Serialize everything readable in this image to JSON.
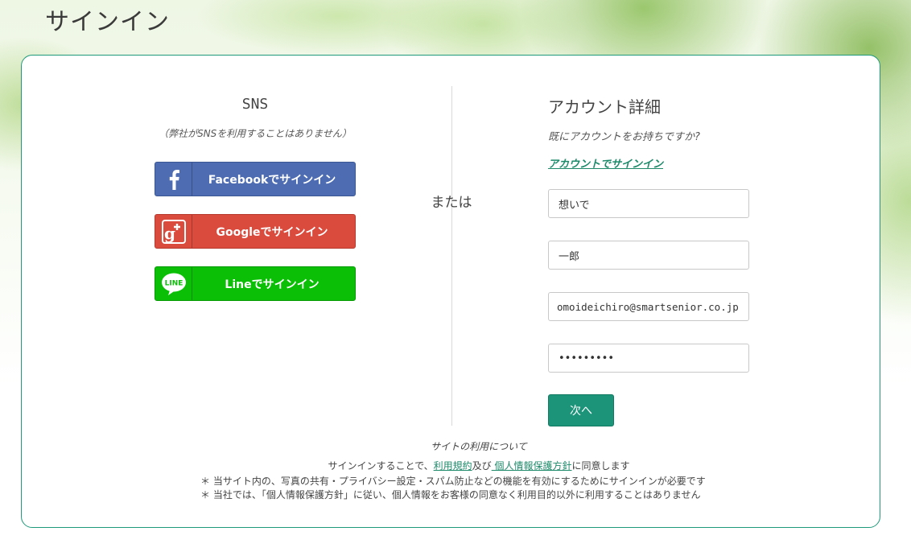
{
  "page": {
    "title": "サインイン"
  },
  "sns": {
    "title": "SNS",
    "note": "（弊社がSNSを利用することはありません）",
    "facebook_label": "Facebookでサインイン",
    "google_label": "Googleでサインイン",
    "line_label": "Lineでサインイン",
    "line_icon_text": "LINE"
  },
  "separator": {
    "or_label": "または"
  },
  "account": {
    "title": "アカウント詳細",
    "question": "既にアカウントをお持ちですか?",
    "signin_link": "アカウントでサインイン",
    "last_name": "想いで",
    "first_name": "一郎",
    "email": "omoideichiro@smartsenior.co.jp",
    "password": "•••••••••",
    "next_label": "次へ"
  },
  "footer": {
    "title": "サイトの利用について",
    "agree_prefix": "サインインすることで、",
    "terms_link": "利用規約",
    "and_text": "及び",
    "privacy_link": " 個人情報保護方針",
    "agree_suffix": "に同意します",
    "note1": "＊ 当サイト内の、写真の共有・プライバシー設定・スパム防止などの機能を有効にするためにサインインが必要です",
    "note2": "＊ 当社では、「個人情報保護方針」に従い、個人情報をお客様の同意なく利用目的以外に利用することはありません"
  },
  "colors": {
    "accent": "#1b9479",
    "facebook": "#4d6cb2",
    "google": "#da4b3e",
    "line": "#0bbf07"
  }
}
